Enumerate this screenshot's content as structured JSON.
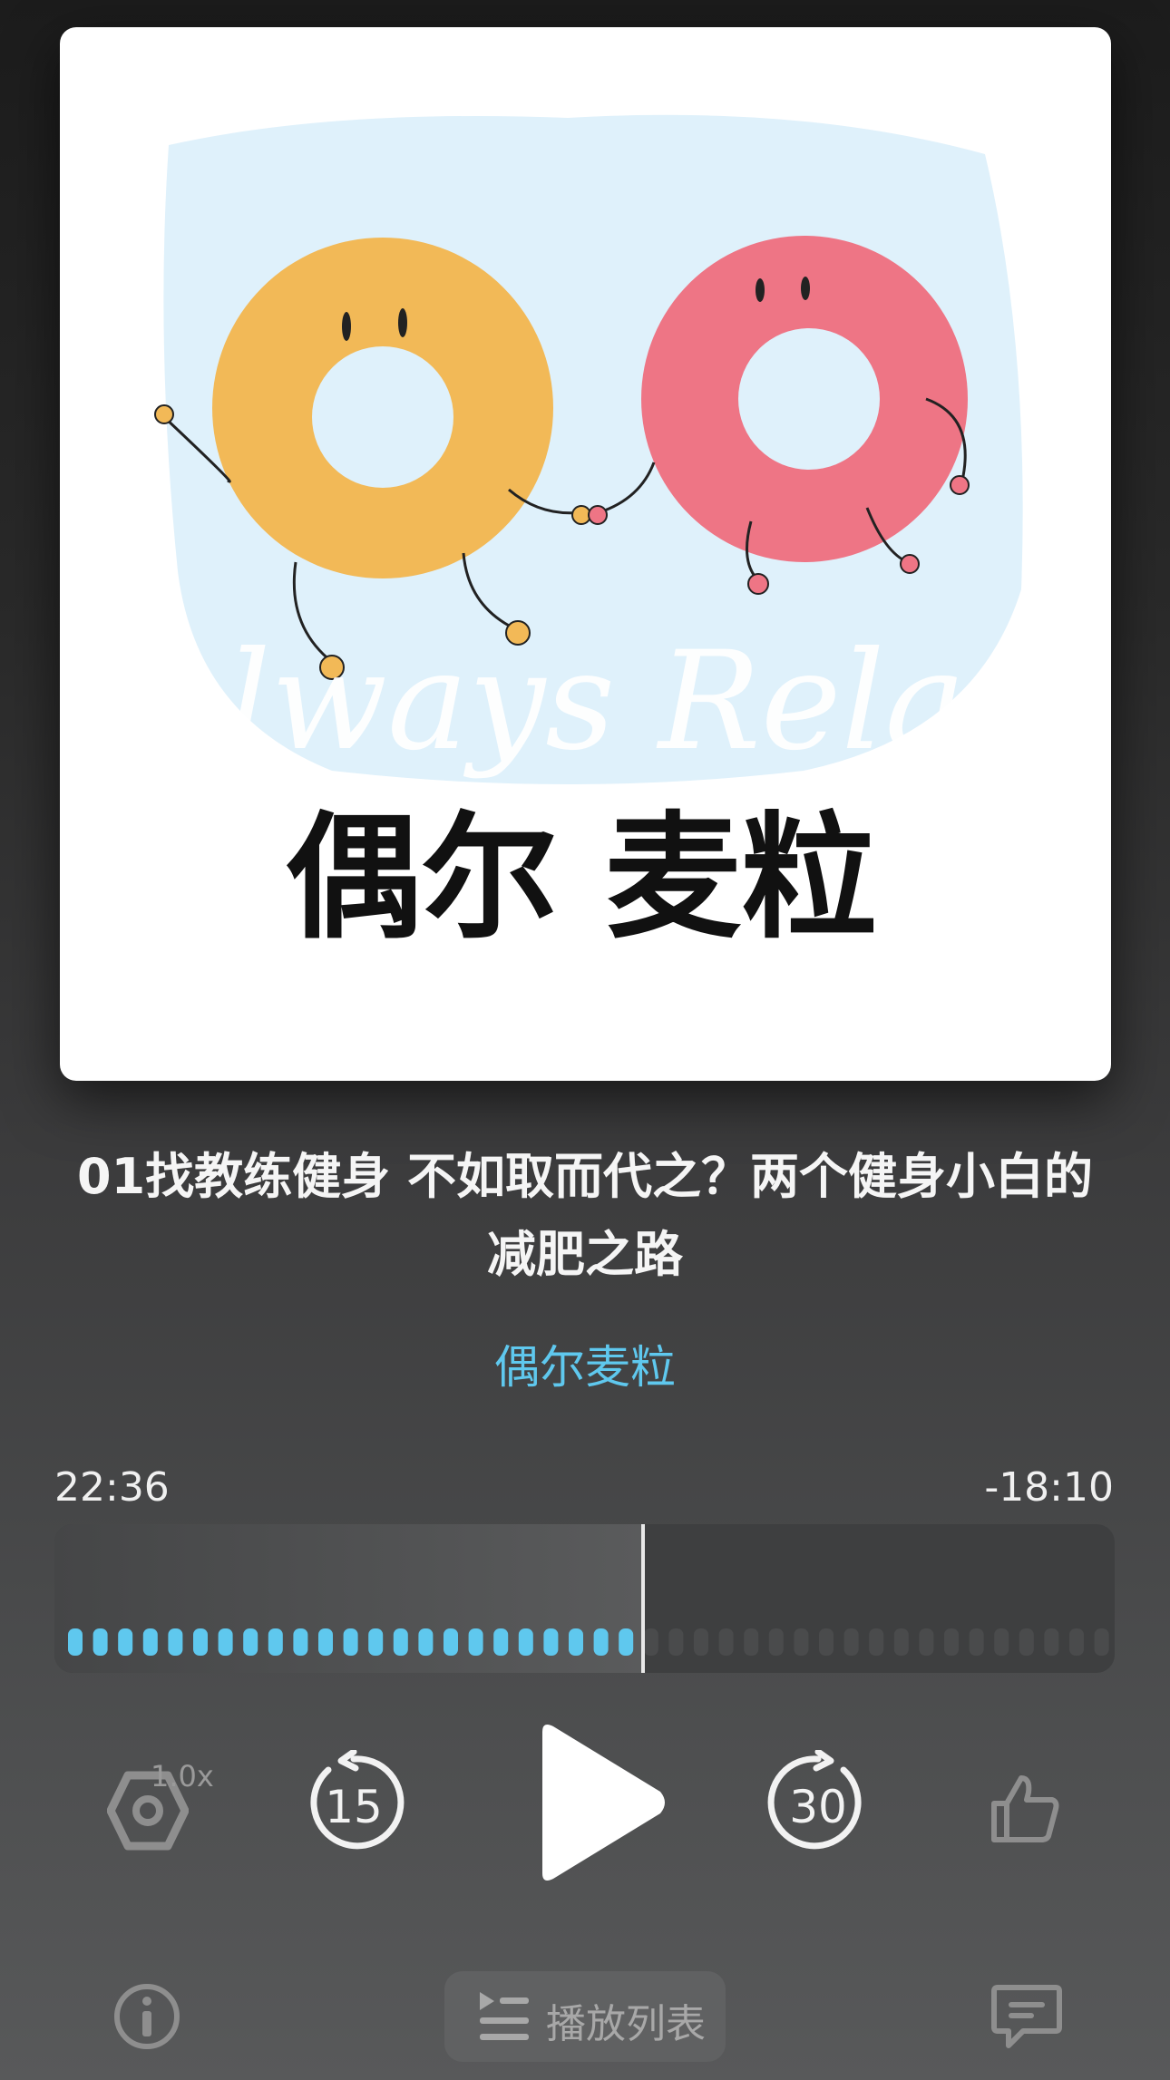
{
  "cover": {
    "watermark": "Always Relax",
    "show_name_art": "偶尔 麦粒"
  },
  "episode": {
    "title": "01找教练健身 不如取而代之？两个健身小白的减肥之路",
    "author": "偶尔麦粒"
  },
  "player": {
    "elapsed": "22:36",
    "remaining": "-18:10",
    "progress_fraction": 0.555,
    "speed": "1.0x",
    "skip_back_seconds": "15",
    "skip_forward_seconds": "30",
    "state": "paused"
  },
  "bottom_bar": {
    "playlist_label": "播放列表"
  },
  "icons": [
    "speed-gear-icon",
    "skip-back-15-icon",
    "play-icon",
    "skip-forward-30-icon",
    "thumbs-up-icon",
    "info-icon",
    "playlist-icon",
    "comment-icon"
  ],
  "colors": {
    "accent": "#5fc8ee",
    "played_bar": "#5fc8ee",
    "unplayed_bar": "#4a4b4c"
  }
}
